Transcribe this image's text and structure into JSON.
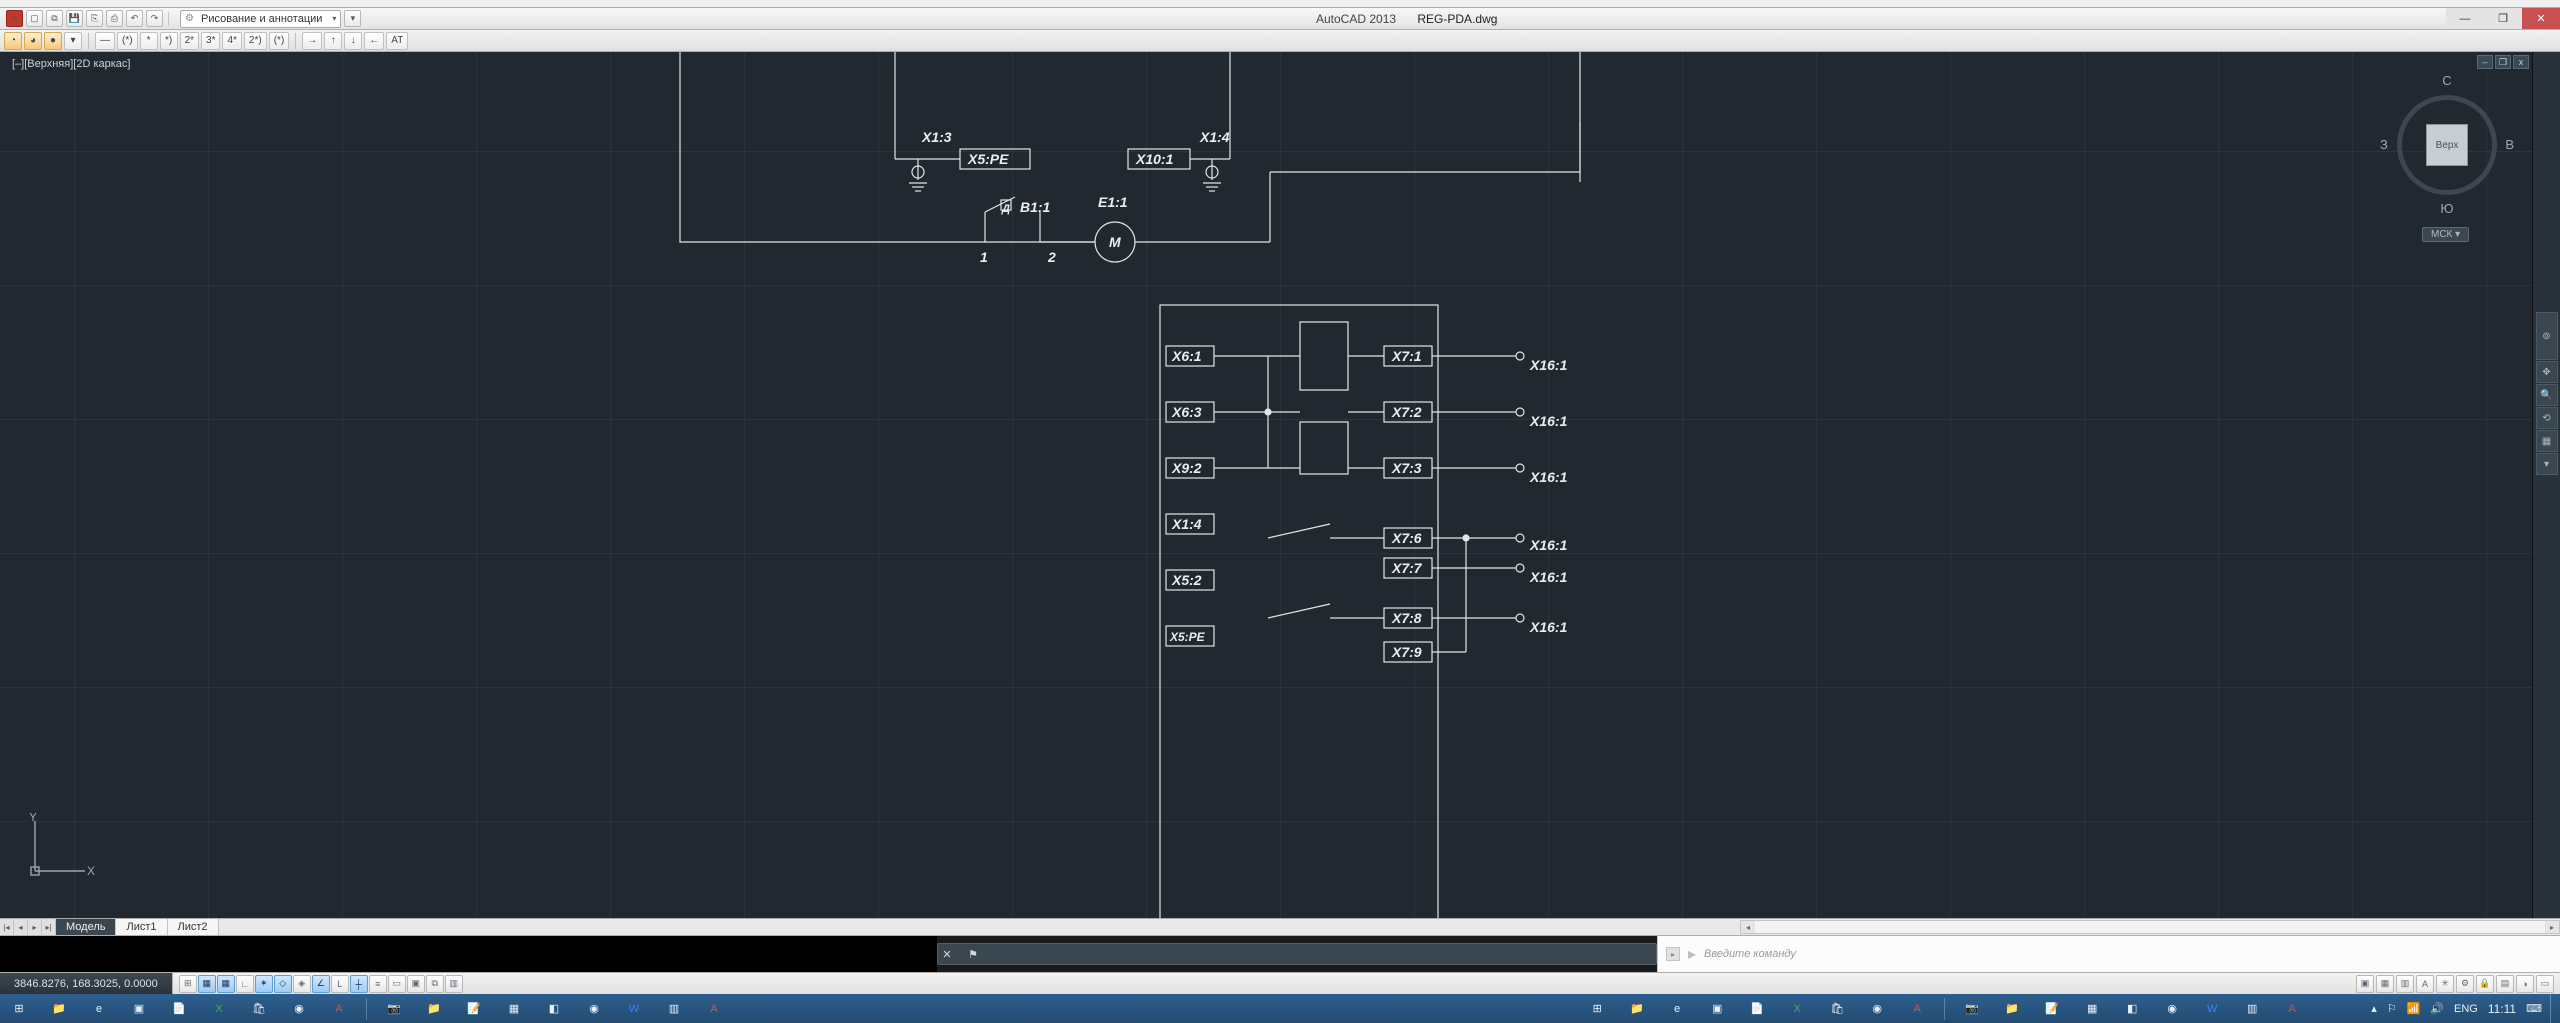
{
  "title": {
    "app": "AutoCAD 2013",
    "file": "REG-PDA.dwg"
  },
  "workspace_selector": "Рисование и аннотации",
  "viewport_label": "[–][Верхняя][2D каркас]",
  "dim_toolbar": [
    "(*)",
    "*",
    "*)",
    "2*",
    "3*",
    "4*",
    "2*)",
    "(*)",
    "→",
    "↑",
    "↓",
    "←",
    "AT"
  ],
  "viewcube": {
    "face": "Верх",
    "n": "С",
    "s": "Ю",
    "e": "В",
    "w": "З",
    "wcs": "МСК ▾"
  },
  "ucs": {
    "x": "X",
    "y": "Y"
  },
  "layout_tabs": {
    "active": "Модель",
    "others": [
      "Лист1",
      "Лист2"
    ]
  },
  "command_hint": "Введите команду",
  "coords": "3846.8276, 168.3025, 0.0000",
  "schematic_labels": {
    "top": {
      "x13": "X1:3",
      "x5pe": "X5:PE",
      "x101": "X10:1",
      "x14": "X1:4",
      "b11_a": "Д",
      "b11": "B1:1",
      "e11": "E1:1",
      "m": "М",
      "n1": "1",
      "n2": "2"
    },
    "left_terms": [
      "X6:1",
      "X6:3",
      "X9:2",
      "X1:4",
      "X5:2",
      "X5:PE"
    ],
    "right_terms": [
      "X7:1",
      "X7:2",
      "X7:3",
      "X7:6",
      "X7:7",
      "X7:8",
      "X7:9"
    ],
    "far_right": [
      "X16:1",
      "X16:1",
      "X16:1",
      "X16:1",
      "X16:1",
      "X16:1"
    ]
  },
  "taskbar": {
    "lang": "ENG",
    "clock": "11:11"
  }
}
